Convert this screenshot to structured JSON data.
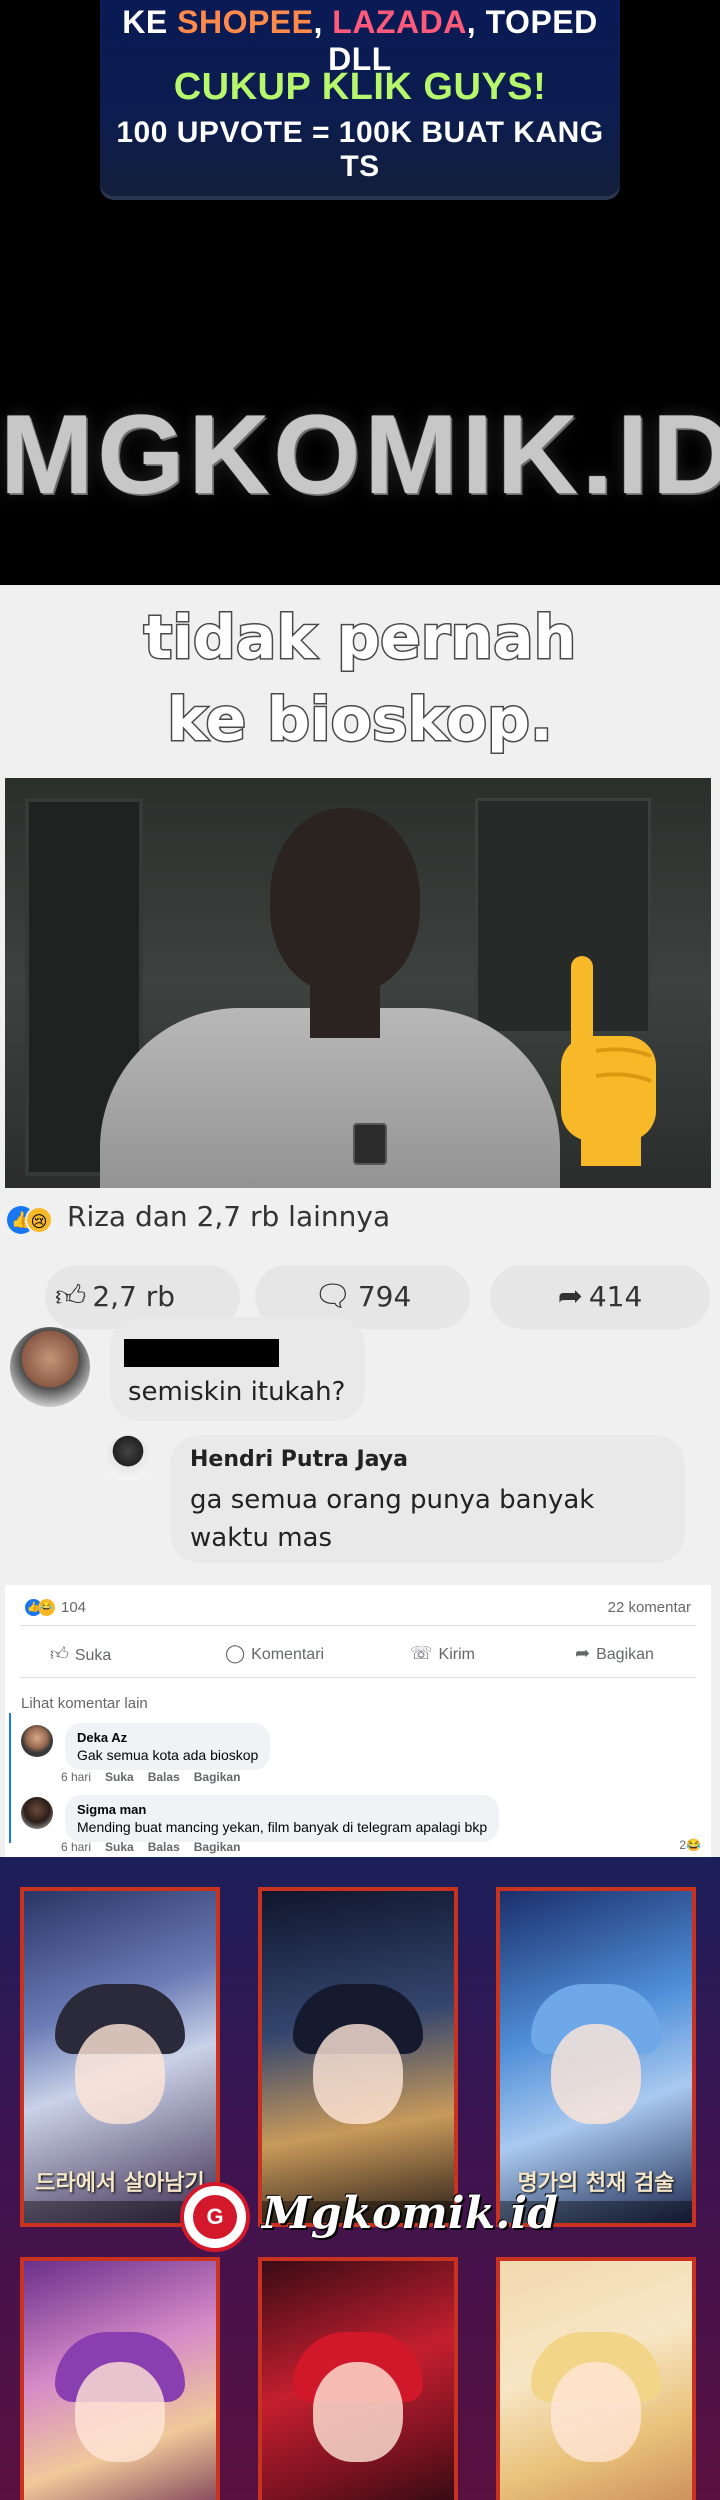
{
  "promo": {
    "line1_prefix": "KE ",
    "shopee": "SHOPEE",
    "comma1": ", ",
    "lazada": "LAZADA",
    "comma2": ", ",
    "toped": "TOPED DLL",
    "line2": "CUKUP KLIK GUYS!",
    "line3": "100 UPVOTE = 100K BUAT KANG TS",
    "site_logo": "MGKOMIK.ID"
  },
  "meme": {
    "caption_line1": "tidak pernah",
    "caption_line2": "ke bioskop.",
    "reactions_text": "Riza dan 2,7 rb lainnya",
    "like_count": "2,7 rb",
    "comment_count": "794",
    "share_count": "414",
    "comment_a_text": "semiskin itukah?",
    "comment_b_name": "Hendri Putra Jaya",
    "comment_b_text": "ga semua orang punya banyak waktu mas"
  },
  "fb": {
    "reaction_count": "104",
    "comment_count": "22 komentar",
    "actions": {
      "like": "Suka",
      "comment": "Komentari",
      "send": "Kirim",
      "share": "Bagikan"
    },
    "more_comments": "Lihat komentar lain",
    "comments": [
      {
        "name": "Deka Az",
        "text": "Gak semua kota ada bioskop",
        "time": "6 hari",
        "like": "Suka",
        "reply": "Balas",
        "share": "Bagikan"
      },
      {
        "name": "Sigma man",
        "text": "Mending buat mancing yekan, film banyak di telegram apalagi bkp",
        "time": "6 hari",
        "like": "Suka",
        "reply": "Balas",
        "share": "Bagikan",
        "reaction_count": "2"
      }
    ]
  },
  "grid": {
    "brand_text": "Mgkomik.id",
    "cover1_title": "드라에서 살아남기",
    "cover3_title": "명가의 천재 검술",
    "colors": {
      "border": "#c8321e",
      "brand_red": "#d3182b"
    }
  }
}
